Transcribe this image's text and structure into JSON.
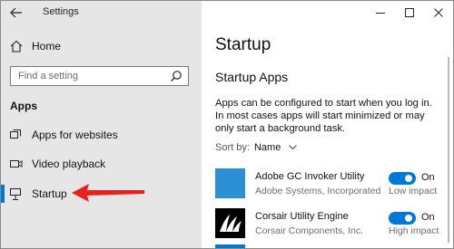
{
  "window": {
    "title": "Settings",
    "controls": {
      "minimize": "minimize",
      "maximize": "maximize",
      "close": "close"
    }
  },
  "sidebar": {
    "home_label": "Home",
    "search_placeholder": "Find a setting",
    "section_title": "Apps",
    "items": [
      {
        "label": "Apps for websites",
        "icon": "apps-for-websites-icon"
      },
      {
        "label": "Video playback",
        "icon": "video-playback-icon"
      },
      {
        "label": "Startup",
        "icon": "startup-icon",
        "selected": true
      }
    ]
  },
  "main": {
    "title": "Startup",
    "subtitle": "Startup Apps",
    "description": "Apps can be configured to start when you log in. In most cases apps will start minimized or may only start a background task.",
    "sort_label": "Sort by:",
    "sort_value": "Name",
    "apps": [
      {
        "name": "Adobe GC Invoker Utility",
        "publisher": "Adobe Systems, Incorporated",
        "state": "On",
        "impact": "Low impact",
        "tile_color": "#2b8fd6"
      },
      {
        "name": "Corsair Utility Engine",
        "publisher": "Corsair Components, Inc.",
        "state": "On",
        "impact": "High impact",
        "tile_color": "#000000"
      }
    ]
  },
  "colors": {
    "accent": "#0078d7",
    "annotation_arrow": "#e8201e",
    "sidebar_bg": "#e6e6e6"
  }
}
